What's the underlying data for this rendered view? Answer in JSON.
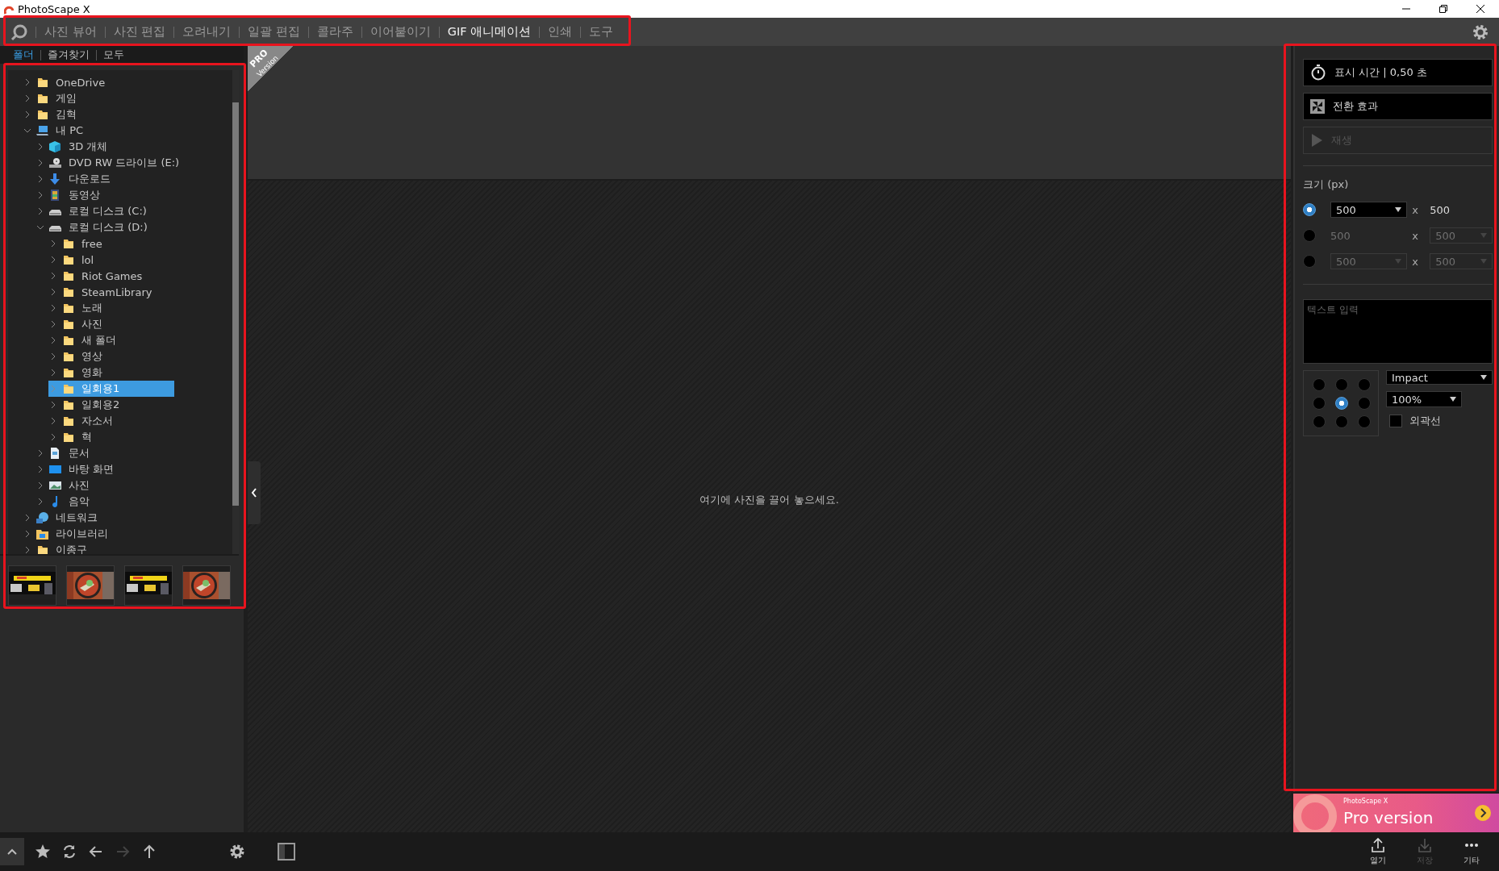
{
  "window": {
    "title": "PhotoScape X"
  },
  "menu": {
    "items": [
      {
        "label": "사진 뷰어",
        "selected": false
      },
      {
        "label": "사진 편집",
        "selected": false
      },
      {
        "label": "오려내기",
        "selected": false
      },
      {
        "label": "일괄 편집",
        "selected": false
      },
      {
        "label": "콜라주",
        "selected": false
      },
      {
        "label": "이어붙이기",
        "selected": false
      },
      {
        "label": "GIF 애니메이션",
        "selected": true
      },
      {
        "label": "인쇄",
        "selected": false
      },
      {
        "label": "도구",
        "selected": false
      }
    ]
  },
  "browser_tabs": [
    {
      "label": "폴더",
      "selected": true
    },
    {
      "label": "즐겨찾기",
      "selected": false
    },
    {
      "label": "모두",
      "selected": false
    }
  ],
  "tree": {
    "items": [
      {
        "label": "OneDrive",
        "kind": "folder",
        "expanded": false,
        "selected": false
      },
      {
        "label": "게임",
        "kind": "folder",
        "expanded": false,
        "selected": false
      },
      {
        "label": "김혁",
        "kind": "folder",
        "expanded": false,
        "selected": false
      },
      {
        "label": "내 PC",
        "kind": "pc",
        "expanded": true,
        "selected": false,
        "children": [
          {
            "label": "3D 개체",
            "kind": "cube",
            "expanded": false,
            "selected": false
          },
          {
            "label": "DVD RW 드라이브 (E:)",
            "kind": "dvd",
            "expanded": false,
            "selected": false
          },
          {
            "label": "다운로드",
            "kind": "download",
            "expanded": false,
            "selected": false
          },
          {
            "label": "동영상",
            "kind": "video",
            "expanded": false,
            "selected": false
          },
          {
            "label": "로컬 디스크 (C:)",
            "kind": "drive",
            "expanded": false,
            "selected": false
          },
          {
            "label": "로컬 디스크 (D:)",
            "kind": "drive",
            "expanded": true,
            "selected": false,
            "children": [
              {
                "label": "free",
                "kind": "folder",
                "expanded": false,
                "selected": false
              },
              {
                "label": "lol",
                "kind": "folder",
                "expanded": false,
                "selected": false
              },
              {
                "label": "Riot Games",
                "kind": "folder",
                "expanded": false,
                "selected": false
              },
              {
                "label": "SteamLibrary",
                "kind": "folder",
                "expanded": false,
                "selected": false
              },
              {
                "label": "노래",
                "kind": "folder",
                "expanded": false,
                "selected": false
              },
              {
                "label": "사진",
                "kind": "folder",
                "expanded": false,
                "selected": false
              },
              {
                "label": "새 폴더",
                "kind": "folder",
                "expanded": false,
                "selected": false
              },
              {
                "label": "영상",
                "kind": "folder",
                "expanded": false,
                "selected": false
              },
              {
                "label": "영화",
                "kind": "folder",
                "expanded": false,
                "selected": false
              },
              {
                "label": "일회용1",
                "kind": "folder",
                "expanded": false,
                "selected": true
              },
              {
                "label": "일회용2",
                "kind": "folder",
                "expanded": false,
                "selected": false
              },
              {
                "label": "자소서",
                "kind": "folder",
                "expanded": false,
                "selected": false
              },
              {
                "label": "혁",
                "kind": "folder",
                "expanded": false,
                "selected": false
              }
            ]
          },
          {
            "label": "문서",
            "kind": "document",
            "expanded": false,
            "selected": false
          },
          {
            "label": "바탕 화면",
            "kind": "desktop",
            "expanded": false,
            "selected": false
          },
          {
            "label": "사진",
            "kind": "picture",
            "expanded": false,
            "selected": false
          },
          {
            "label": "음악",
            "kind": "music",
            "expanded": false,
            "selected": false
          }
        ]
      },
      {
        "label": "네트워크",
        "kind": "network",
        "expanded": false,
        "selected": false
      },
      {
        "label": "라이브러리",
        "kind": "library",
        "expanded": false,
        "selected": false
      },
      {
        "label": "이종구",
        "kind": "folder",
        "expanded": false,
        "selected": false
      }
    ]
  },
  "stage": {
    "ribbon_title": "PRO",
    "ribbon_subtitle": "Version",
    "hint": "여기에 사진을 끌어 놓으세요."
  },
  "settings": {
    "actions": [
      {
        "label": "표시 시간 | 0,50 초",
        "kind": "timer",
        "disabled": false
      },
      {
        "label": "전환 효과",
        "kind": "transition",
        "disabled": false
      },
      {
        "label": "재생",
        "kind": "play",
        "disabled": true
      }
    ],
    "size_label": "크기 (px)",
    "size_options": [
      {
        "selected": true,
        "width": {
          "kind": "dropdown",
          "value": "500",
          "disabled": false
        },
        "separator": "x",
        "height": {
          "kind": "text",
          "value": "500",
          "disabled": false
        }
      },
      {
        "selected": false,
        "width": {
          "kind": "text",
          "value": "500",
          "disabled": true
        },
        "separator": "x",
        "height": {
          "kind": "dropdown",
          "value": "500",
          "disabled": true
        }
      },
      {
        "selected": false,
        "width": {
          "kind": "dropdown",
          "value": "500",
          "disabled": true
        },
        "separator": "x",
        "height": {
          "kind": "dropdown",
          "value": "500",
          "disabled": true
        }
      }
    ],
    "text_input": {
      "placeholder": "텍스트 입력"
    },
    "alignment": [
      {
        "selected": false
      },
      {
        "selected": false
      },
      {
        "selected": false
      },
      {
        "selected": false
      },
      {
        "selected": true
      },
      {
        "selected": false
      },
      {
        "selected": false
      },
      {
        "selected": false
      },
      {
        "selected": false
      }
    ],
    "font": "Impact",
    "font_size": "100%",
    "outline": {
      "label": "외곽선",
      "checked": false
    }
  },
  "promo": {
    "brand": "PhotoScape X",
    "title": "Pro version"
  },
  "bottom_left": [
    {
      "kind": "collapse",
      "disabled": false
    },
    {
      "kind": "star",
      "disabled": false
    },
    {
      "kind": "refresh",
      "disabled": false
    },
    {
      "kind": "back",
      "disabled": false
    },
    {
      "kind": "forward",
      "disabled": true
    },
    {
      "kind": "up",
      "disabled": false
    },
    {
      "kind": "settings",
      "disabled": false
    }
  ],
  "bottom_right": [
    {
      "kind": "open",
      "label": "열기",
      "disabled": false
    },
    {
      "kind": "save",
      "label": "저장",
      "disabled": true
    },
    {
      "kind": "more",
      "label": "기타",
      "disabled": false
    }
  ],
  "highlights": {
    "menu": true,
    "browser": true,
    "settings": true
  }
}
